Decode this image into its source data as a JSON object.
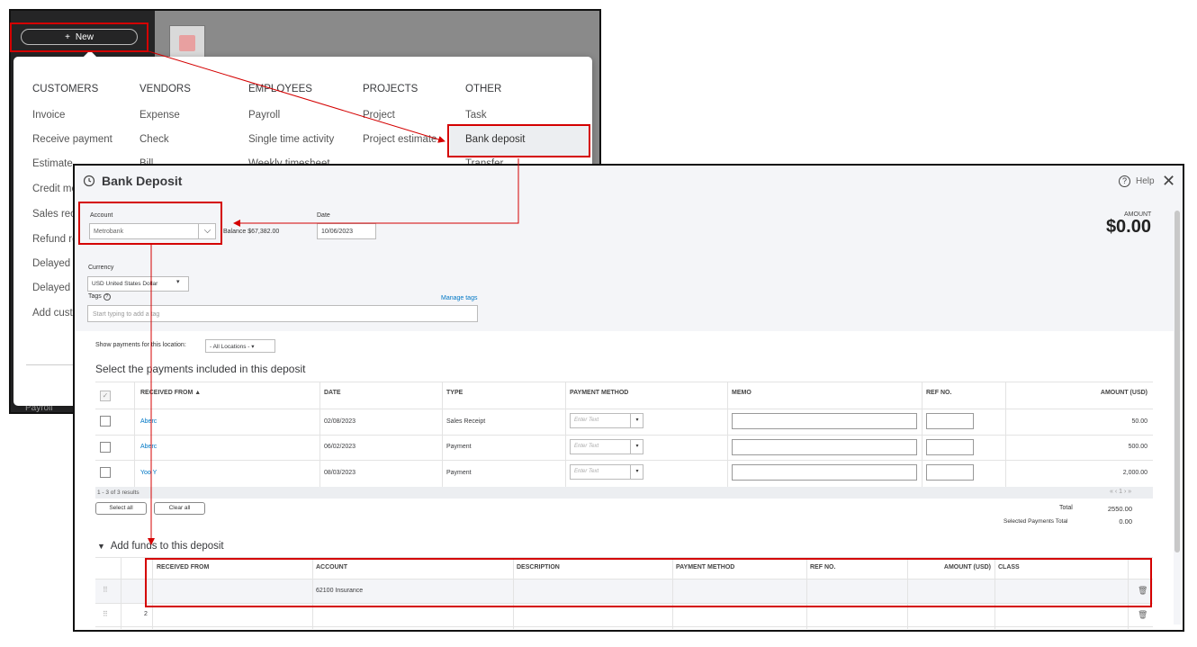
{
  "app_bar": {
    "new_label": "New"
  },
  "bg_peek": {
    "payroll": "Payroll"
  },
  "new_menu": {
    "columns": [
      {
        "heading": "CUSTOMERS",
        "items": [
          "Invoice",
          "Receive payment",
          "Estimate",
          "Credit me",
          "Sales rec",
          "Refund re",
          "Delayed",
          "Delayed",
          "Add cust"
        ]
      },
      {
        "heading": "VENDORS",
        "items": [
          "Expense",
          "Check",
          "Bill"
        ]
      },
      {
        "heading": "EMPLOYEES",
        "items": [
          "Payroll",
          "Single time activity",
          "Weekly timesheet"
        ]
      },
      {
        "heading": "PROJECTS",
        "items": [
          "Project",
          "Project estimate"
        ]
      },
      {
        "heading": "OTHER",
        "items": [
          "Task",
          "Bank deposit",
          "Transfer"
        ]
      }
    ]
  },
  "dialog": {
    "title": "Bank Deposit",
    "help": "Help",
    "account_label": "Account",
    "account_value": "Metrobank",
    "balance": "Balance $67,382.00",
    "date_label": "Date",
    "date_value": "10/06/2023",
    "amount_label": "AMOUNT",
    "amount_value": "$0.00",
    "currency_label": "Currency",
    "currency_value": "USD United States Dollar",
    "tags_label": "Tags",
    "manage_tags": "Manage tags",
    "tags_placeholder": "Start typing to add a tag",
    "location_label": "Show payments for this location:",
    "location_value": "- All Locations -",
    "section_title": "Select the payments included in this deposit",
    "columns": {
      "received_from": "RECEIVED FROM ▲",
      "date": "DATE",
      "type": "TYPE",
      "payment_method": "PAYMENT METHOD",
      "memo": "MEMO",
      "ref_no": "REF NO.",
      "amount": "AMOUNT (USD)"
    },
    "payments": [
      {
        "received_from": "Aberc",
        "date": "02/08/2023",
        "type": "Sales Receipt",
        "payment_method_placeholder": "Enter Text",
        "amount": "50.00"
      },
      {
        "received_from": "Aberc",
        "date": "06/02/2023",
        "type": "Payment",
        "payment_method_placeholder": "Enter Text",
        "amount": "500.00"
      },
      {
        "received_from": "Yoo Y",
        "date": "08/03/2023",
        "type": "Payment",
        "payment_method_placeholder": "Enter Text",
        "amount": "2,000.00"
      }
    ],
    "results": "1 - 3 of 3 results",
    "pager": "« ‹ 1 › »",
    "select_all": "Select all",
    "clear_all": "Clear all",
    "total_label": "Total",
    "total_value": "2550.00",
    "selected_label": "Selected Payments Total",
    "selected_value": "0.00",
    "funds_title": "Add funds to this deposit",
    "funds_columns": {
      "received_from": "RECEIVED FROM",
      "account": "ACCOUNT",
      "description": "DESCRIPTION",
      "payment_method": "PAYMENT METHOD",
      "ref_no": "REF NO.",
      "amount": "AMOUNT (USD)",
      "class": "CLASS"
    },
    "funds_rows": [
      {
        "line": "",
        "account": "62100 Insurance"
      },
      {
        "line": "2",
        "account": ""
      }
    ]
  },
  "colors": {
    "highlight": "#d40000",
    "link": "#0077c5",
    "sidebar": "#252526"
  }
}
